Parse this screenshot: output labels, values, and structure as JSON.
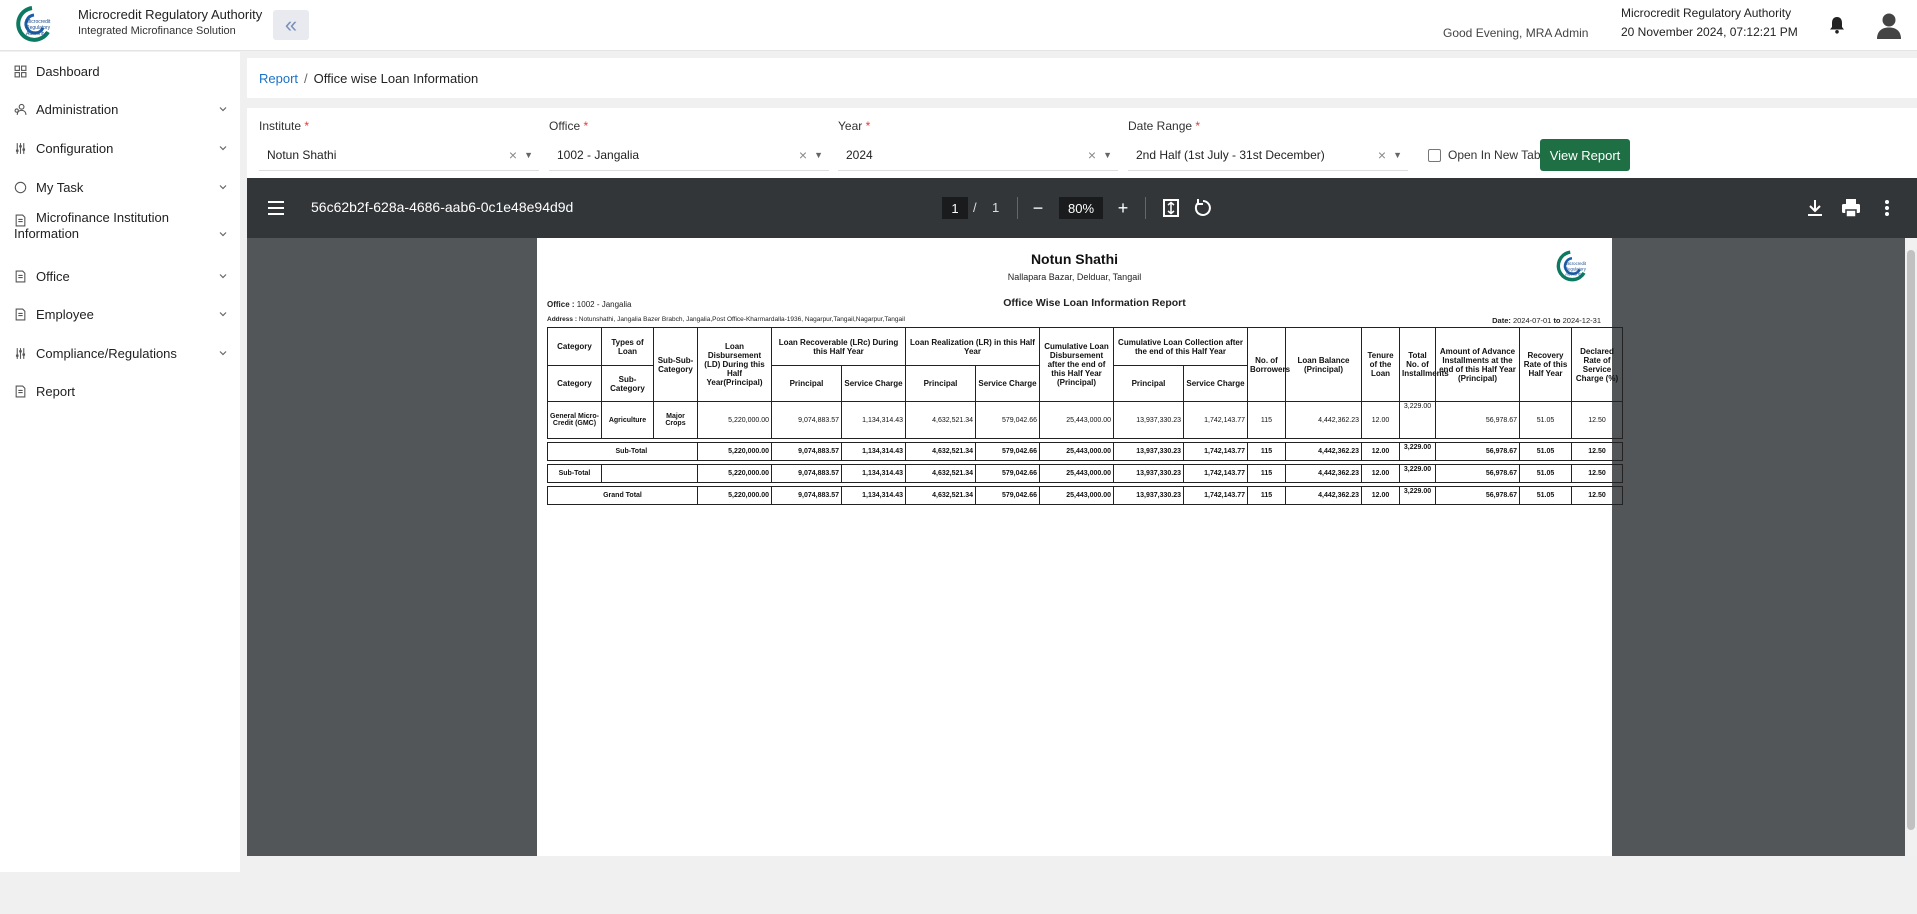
{
  "header": {
    "org_name": "Microcredit Regulatory Authority",
    "org_subtitle": "Integrated Microfinance Solution",
    "greeting": "Good Evening, MRA Admin",
    "right_org": "Microcredit Regulatory Authority",
    "datetime": "20 November 2024, 07:12:21 PM",
    "logo_text": "Microcredit Regulatory Authority"
  },
  "sidebar": {
    "items": [
      {
        "label": "Dashboard",
        "icon": "grid-icon",
        "has_children": false
      },
      {
        "label": "Administration",
        "icon": "users-icon",
        "has_children": true
      },
      {
        "label": "Configuration",
        "icon": "sliders-icon",
        "has_children": true
      },
      {
        "label": "My Task",
        "icon": "task-icon",
        "has_children": true
      },
      {
        "label": "Microfinance Institution",
        "label2": "Information",
        "icon": "document-icon",
        "has_children": true
      },
      {
        "label": "Office",
        "icon": "document-icon",
        "has_children": true
      },
      {
        "label": "Employee",
        "icon": "document-icon",
        "has_children": true
      },
      {
        "label": "Compliance/Regulations",
        "icon": "sliders-icon",
        "has_children": true
      },
      {
        "label": "Report",
        "icon": "document-icon",
        "has_children": false
      }
    ]
  },
  "breadcrumb": {
    "root": "Report",
    "separator": "/",
    "current": "Office wise Loan Information"
  },
  "filters": {
    "institute": {
      "label": "Institute",
      "value": "Notun Shathi"
    },
    "office": {
      "label": "Office",
      "value": "1002 - Jangalia"
    },
    "year": {
      "label": "Year",
      "value": "2024"
    },
    "date_range": {
      "label": "Date Range",
      "value": "2nd Half (1st July - 31st December)"
    },
    "required_mark": "*",
    "open_new_tab": "Open In New Tab",
    "view_report": "View Report"
  },
  "viewer": {
    "file_name": "56c62b2f-628a-4686-aab6-0c1e48e94d9d",
    "page": "1",
    "of": "/",
    "total_pages": "1",
    "zoom": "80%"
  },
  "report": {
    "institute": "Notun Shathi",
    "institute_address": "Nallapara Bazar, Delduar, Tangail",
    "office_label": "Office :",
    "office_value": "1002 - Jangalia",
    "title": "Office Wise Loan Information Report",
    "address_label": "Address :",
    "address_value": "Notunshathi, Jangalia Bazer Brabch, Jangalia,Post Office-Kharmardalla-1936, Nagarpur,Tangail,Nagarpur,Tangail",
    "date_label": "Date:",
    "date_from": "2024-07-01",
    "date_to_word": "to",
    "date_to": "2024-12-31",
    "headers": {
      "category": "Category",
      "types_of_loan": "Types of Loan",
      "sub_sub_category": "Sub-Sub-Category",
      "loan_disbursement": "Loan Disbursement (LD) During this Half Year(Principal)",
      "loan_recoverable": "Loan Recoverable (LRc) During this Half Year",
      "loan_realization": "Loan Realization (LR) in this Half Year",
      "cumulative_disbursement": "Cumulative Loan Disbursement after the end of this Half Year (Principal)",
      "cumulative_collection": "Cumulative Loan Collection after the end of this Half Year",
      "no_of_borrowers": "No. of Borrowers",
      "loan_balance": "Loan Balance (Principal)",
      "tenure": "Tenure of the Loan",
      "total_installments": "Total No. of Installments",
      "advance_installments": "Amount of Advance Installments at the end of this Half Year (Principal)",
      "recovery_rate": "Recovery Rate of this Half Year",
      "declared_rate": "Declared Rate of Service Charge (%)",
      "sub_category_col": "Category",
      "sub_category": "Sub-Category",
      "principal": "Principal",
      "service_charge": "Service Charge"
    },
    "rows": [
      {
        "category": "General Micro-Credit (GMC)",
        "sub_category": "Agriculture",
        "sub_sub_category": "Major Crops",
        "ld": "5,220,000.00",
        "lrc_p": "9,074,883.57",
        "lrc_s": "1,134,314.43",
        "lr_p": "4,632,521.34",
        "lr_s": "579,042.66",
        "cum_d": "25,443,000.00",
        "cum_c_p": "13,937,330.23",
        "cum_c_s": "1,742,143.77",
        "borrowers": "115",
        "balance": "4,442,362.23",
        "tenure": "12.00",
        "installments": "3,229.00",
        "advance": "56,978.67",
        "recovery": "51.05",
        "declared": "12.50"
      }
    ],
    "totals": [
      {
        "label": "Sub-Total",
        "ld": "5,220,000.00",
        "lrc_p": "9,074,883.57",
        "lrc_s": "1,134,314.43",
        "lr_p": "4,632,521.34",
        "lr_s": "579,042.66",
        "cum_d": "25,443,000.00",
        "cum_c_p": "13,937,330.23",
        "cum_c_s": "1,742,143.77",
        "borrowers": "115",
        "balance": "4,442,362.23",
        "tenure": "12.00",
        "installments": "3,229.00",
        "advance": "56,978.67",
        "recovery": "51.05",
        "declared": "12.50"
      },
      {
        "label": "Sub-Total",
        "ld": "5,220,000.00",
        "lrc_p": "9,074,883.57",
        "lrc_s": "1,134,314.43",
        "lr_p": "4,632,521.34",
        "lr_s": "579,042.66",
        "cum_d": "25,443,000.00",
        "cum_c_p": "13,937,330.23",
        "cum_c_s": "1,742,143.77",
        "borrowers": "115",
        "balance": "4,442,362.23",
        "tenure": "12.00",
        "installments": "3,229.00",
        "advance": "56,978.67",
        "recovery": "51.05",
        "declared": "12.50"
      },
      {
        "label": "Grand Total",
        "ld": "5,220,000.00",
        "lrc_p": "9,074,883.57",
        "lrc_s": "1,134,314.43",
        "lr_p": "4,632,521.34",
        "lr_s": "579,042.66",
        "cum_d": "25,443,000.00",
        "cum_c_p": "13,937,330.23",
        "cum_c_s": "1,742,143.77",
        "borrowers": "115",
        "balance": "4,442,362.23",
        "tenure": "12.00",
        "installments": "3,229.00",
        "advance": "56,978.67",
        "recovery": "51.05",
        "declared": "12.50"
      }
    ]
  },
  "colors": {
    "accent": "#1a73c8",
    "primary_button": "#1f6f45",
    "viewer_bg": "#525659",
    "toolbar_bg": "#323639"
  }
}
